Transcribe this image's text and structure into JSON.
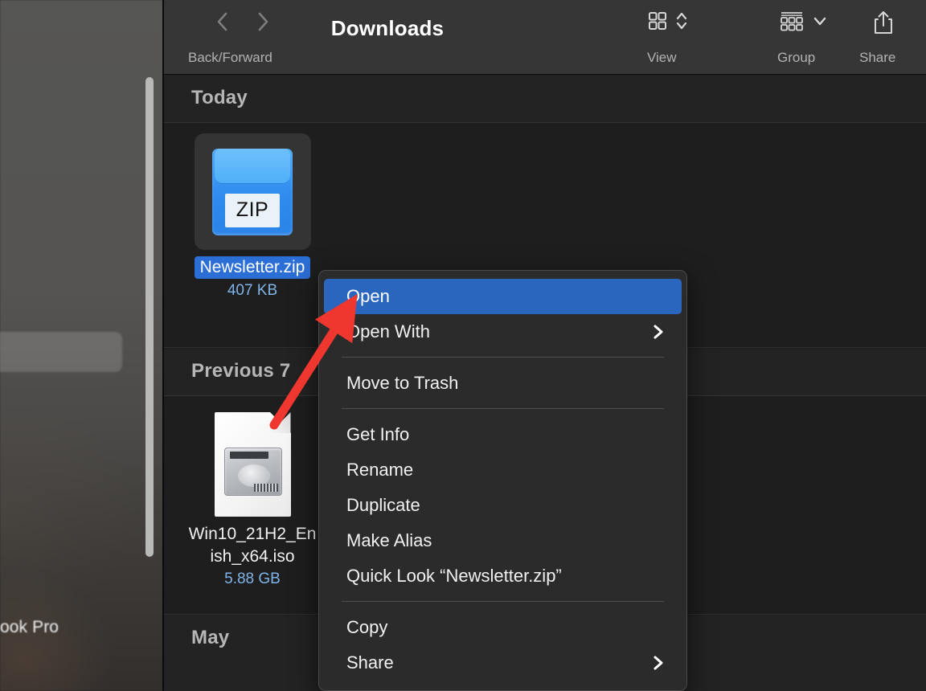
{
  "window": {
    "title": "Downloads"
  },
  "toolbar": {
    "back_forward_label": "Back/Forward",
    "back_icon": "chevron-left-icon",
    "forward_icon": "chevron-right-icon",
    "view_label": "View",
    "view_icon": "grid-view-icon",
    "view_chevron_icon": "chevron-up-down-icon",
    "group_label": "Group",
    "group_icon": "group-list-icon",
    "group_chevron_icon": "chevron-down-icon",
    "share_label": "Share",
    "share_icon": "share-upload-icon"
  },
  "sidebar": {
    "device_label": "ook Pro",
    "scrollbar": "vertical-scrollbar"
  },
  "sections": [
    {
      "header": "Today",
      "files": [
        {
          "name": "Newsletter.zip",
          "size": "407 KB",
          "icon": "zip-archive-icon",
          "badge": "ZIP",
          "selected": true
        }
      ]
    },
    {
      "header": "Previous 7",
      "files": [
        {
          "name_line1": "Win10_21H2_En",
          "name_line2": "ish_x64.iso",
          "size": "5.88 GB",
          "icon": "iso-disk-image-icon",
          "selected": false
        }
      ]
    },
    {
      "header": "May",
      "files": []
    }
  ],
  "context_menu": {
    "items": [
      {
        "label": "Open",
        "selected": true,
        "submenu": false
      },
      {
        "label": "Open With",
        "selected": false,
        "submenu": true
      },
      {
        "separator": true
      },
      {
        "label": "Move to Trash",
        "selected": false,
        "submenu": false
      },
      {
        "separator": true
      },
      {
        "label": "Get Info",
        "selected": false,
        "submenu": false
      },
      {
        "label": "Rename",
        "selected": false,
        "submenu": false
      },
      {
        "label": "Duplicate",
        "selected": false,
        "submenu": false
      },
      {
        "label": "Make Alias",
        "selected": false,
        "submenu": false
      },
      {
        "label": "Quick Look “Newsletter.zip”",
        "selected": false,
        "submenu": false
      },
      {
        "separator": true
      },
      {
        "label": "Copy",
        "selected": false,
        "submenu": false
      },
      {
        "label": "Share",
        "selected": false,
        "submenu": true
      }
    ]
  },
  "annotation": {
    "pointer": "red-arrow-annotation"
  },
  "colors": {
    "accent_blue": "#2b66be",
    "selection_blue": "#2b6fd6",
    "file_size_blue": "#7fb4e9",
    "menu_background": "#2b2b2b",
    "toolbar_background": "#363636",
    "content_background": "#1e1e1e",
    "annotation_red": "#f0372f"
  }
}
